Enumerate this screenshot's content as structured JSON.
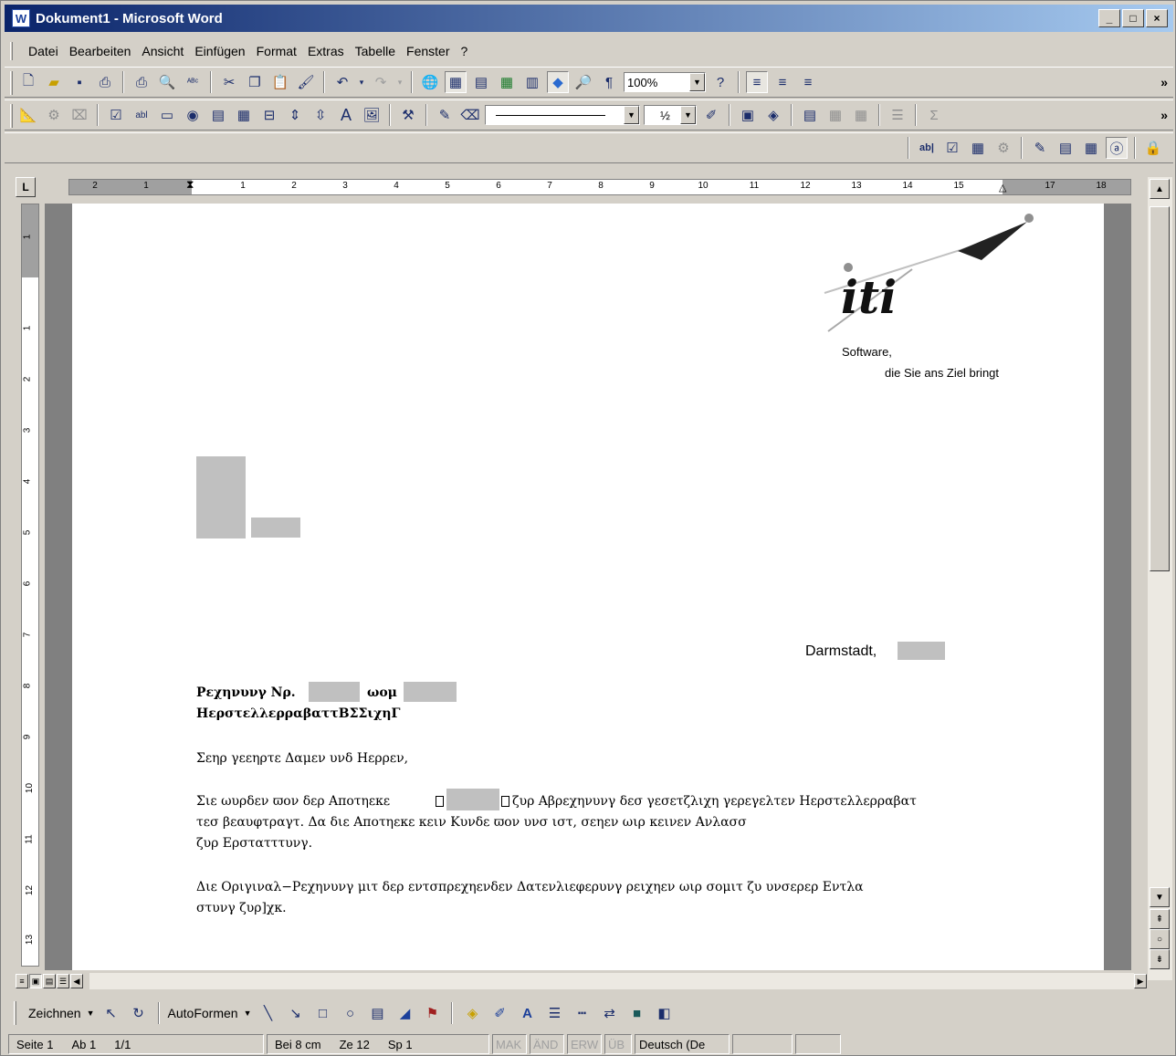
{
  "window": {
    "title": "Dokument1 - Microsoft Word",
    "app_icon": "W",
    "min": "_",
    "max": "□",
    "close": "×"
  },
  "menu": [
    "Datei",
    "Bearbeiten",
    "Ansicht",
    "Einfügen",
    "Format",
    "Extras",
    "Tabelle",
    "Fenster",
    "?"
  ],
  "toolbar_standard": {
    "zoom": "100%"
  },
  "toolbar_forms": {
    "line_style_value": "",
    "line_width": "½"
  },
  "ruler": {
    "h_numbers": [
      "2",
      "1",
      "1",
      "2",
      "3",
      "4",
      "5",
      "6",
      "7",
      "8",
      "9",
      "10",
      "11",
      "12",
      "13",
      "14",
      "15",
      "17",
      "18"
    ],
    "v_numbers": [
      "1",
      "1",
      "2",
      "3",
      "4",
      "5",
      "6",
      "7",
      "8",
      "9",
      "10",
      "11",
      "12",
      "13"
    ],
    "tab_selector": "L"
  },
  "document": {
    "logo_text": "iti",
    "logo_tagline_1": "Software,",
    "logo_tagline_2": "die Sie ans Ziel bringt",
    "date_prefix": "Darmstadt,",
    "subject_line1_a": "Ρεχηνυνγ Νρ.",
    "subject_line1_b": "ωομ",
    "subject_line2": "ΗερστελλερραβαττΒΣΣιχηΓ",
    "salutation": "Σεηρ γεεηρτε Δαμεν υνδ Ηερρεν,",
    "para1_line1_a": "Σιε ωυρδεν ϖον δερ Αποτηεκε",
    "para1_line1_b": "ζυρ Αβρεχηνυνγ δεσ γεσετζλιχη γερεγελτεν Ηερστελλερραβατ",
    "para1_line2": "τεσ βεαυφτραγτ. Δα διε Αποτηεκε κειν Κυνδε ϖον υνσ ιστ, σεηεν ωιρ κεινεν Ανλασσ",
    "para1_line3": "ζυρ Ερστατττυνγ.",
    "para2_line1": "Διε Οριγιναλ−Ρεχηνυνγ μιτ δερ εντσπρεχηενδεν Δατενλιεφερυνγ ρειχηεν ωιρ σομιτ ζυ υνσερερ Εντλα",
    "para2_line2": "στυνγ ζυρ]χκ."
  },
  "drawing_toolbar": {
    "draw_label": "Zeichnen",
    "autoshapes_label": "AutoFormen"
  },
  "status": {
    "page": "Seite 1",
    "section": "Ab 1",
    "pages": "1/1",
    "position": "Bei 8 cm",
    "line": "Ze 12",
    "column": "Sp 1",
    "mak": "MAK",
    "and": "ÄND",
    "erw": "ERW",
    "ub": "ÜB",
    "language": "Deutsch (De"
  }
}
